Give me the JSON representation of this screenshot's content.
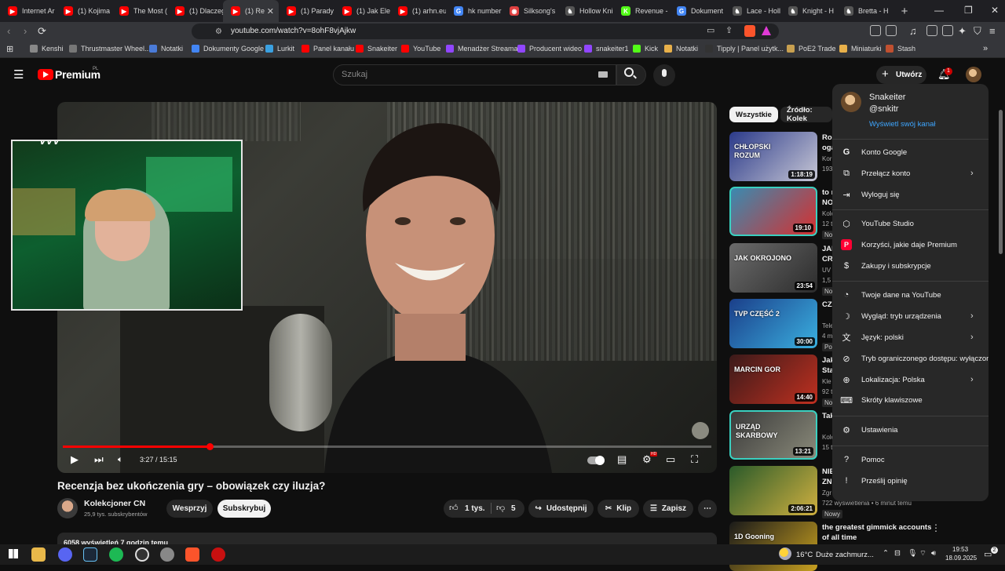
{
  "browser": {
    "tabs": [
      {
        "label": "Internet Ar",
        "fav": "#ff0000",
        "fav_glyph": "▶"
      },
      {
        "label": "(1) Kojima",
        "fav": "#ff0000",
        "fav_glyph": "▶"
      },
      {
        "label": "The Most (",
        "fav": "#ff0000",
        "fav_glyph": "▶"
      },
      {
        "label": "(1) Dlaczeg",
        "fav": "#ff0000",
        "fav_glyph": "▶"
      },
      {
        "label": "(1) Re",
        "fav": "#ff0000",
        "fav_glyph": "▶",
        "active": true
      },
      {
        "label": "(1) Parady",
        "fav": "#ff0000",
        "fav_glyph": "▶"
      },
      {
        "label": "(1) Jak Ele",
        "fav": "#ff0000",
        "fav_glyph": "▶"
      },
      {
        "label": "(1) arhn.eu",
        "fav": "#ff0000",
        "fav_glyph": "▶"
      },
      {
        "label": "hk number",
        "fav": "#4285f4",
        "fav_glyph": "G"
      },
      {
        "label": "Silksong's",
        "fav": "#e04040",
        "fav_glyph": "◉"
      },
      {
        "label": "Hollow Kni",
        "fav": "#555555",
        "fav_glyph": "♞"
      },
      {
        "label": "Revenue -",
        "fav": "#53fc18",
        "fav_glyph": "K"
      },
      {
        "label": "Dokument",
        "fav": "#4285f4",
        "fav_glyph": "G"
      },
      {
        "label": "Lace - Holl",
        "fav": "#555555",
        "fav_glyph": "♞"
      },
      {
        "label": "Knight - H",
        "fav": "#555555",
        "fav_glyph": "♞"
      },
      {
        "label": "Bretta - H",
        "fav": "#555555",
        "fav_glyph": "♞"
      }
    ],
    "url": "youtube.com/watch?v=8ohF8vjAjkw",
    "bookmarks": [
      {
        "label": "Kenshi",
        "color": "#888888"
      },
      {
        "label": "Thrustmaster Wheel...",
        "color": "#777777"
      },
      {
        "label": "Notatki",
        "color": "#4a7bd8"
      },
      {
        "label": "Dokumenty Google",
        "color": "#4285f4"
      },
      {
        "label": "Lurkit",
        "color": "#3aa0e0"
      },
      {
        "label": "Panel kanału",
        "color": "#ff0000"
      },
      {
        "label": "Snakeiter",
        "color": "#ff0000"
      },
      {
        "label": "YouTube",
        "color": "#ff0000"
      },
      {
        "label": "Menadżer Streama",
        "color": "#9146ff"
      },
      {
        "label": "Producent wideo",
        "color": "#9146ff"
      },
      {
        "label": "snakeiter1",
        "color": "#9146ff"
      },
      {
        "label": "Kick",
        "color": "#53fc18"
      },
      {
        "label": "Notatki",
        "color": "#e8b04a"
      },
      {
        "label": "Tipply | Panel użytk...",
        "color": "#333333"
      },
      {
        "label": "PoE2 Trade",
        "color": "#c8a050"
      },
      {
        "label": "Miniaturki",
        "color": "#e8b04a"
      },
      {
        "label": "Stash",
        "color": "#c05030"
      }
    ]
  },
  "youtube": {
    "logo_text": "Premium",
    "logo_region": "PL",
    "search_placeholder": "Szukaj",
    "create_label": "Utwórz",
    "notif_count": "1"
  },
  "player": {
    "time_current": "3:27",
    "time_total": "15:15",
    "time_display": "3:27 / 15:15",
    "progress": 0.226,
    "quality_badge": "HD"
  },
  "video": {
    "title": "Recenzja bez ukończenia gry – obowiązek czy iluzja?",
    "channel": "Kolekcjoner CN",
    "subscribers": "25,9 tys. subskrybentów",
    "support_label": "Wesprzyj",
    "subscribe_label": "Subskrybuj",
    "likes": "1 tys.",
    "dislikes": "5",
    "share_label": "Udostępnij",
    "clip_label": "Klip",
    "save_label": "Zapisz",
    "desc_stats": "6058 wyświetleń  7 godzin temu"
  },
  "sidebar": {
    "chips": [
      {
        "label": "Wszystkie",
        "active": true
      },
      {
        "label": "Źródło: Kolek",
        "active": false
      }
    ],
    "items": [
      {
        "title": "Rol",
        "title2": "oga",
        "meta": "Kor",
        "meta2": "193",
        "duration": "1:18:19",
        "thumb_text": "CHŁOPSKI ROZUM",
        "bg1": "#2b3a8a",
        "bg2": "#c7c7d5"
      },
      {
        "title": "to r",
        "title2": "NO",
        "meta": "Kolo",
        "meta2": "12 t",
        "badge": "No",
        "duration": "19:10",
        "thumb_text": "",
        "bg1": "#3a8ab0",
        "bg2": "#d63030"
      },
      {
        "title": "JAK",
        "title2": "CRI",
        "meta": "UV",
        "meta2": "1,5",
        "badge": "No",
        "duration": "23:54",
        "thumb_text": "JAK OKROJONO",
        "bg1": "#6b6b6b",
        "bg2": "#2c2c2c"
      },
      {
        "title": "CZ",
        "title2": "",
        "meta": "Tele",
        "meta2": "4 m",
        "badge": "Po",
        "duration": "30:00",
        "thumb_text": "TVP  CZĘŚĆ 2",
        "bg1": "#1b3f8a",
        "bg2": "#3ab0e0"
      },
      {
        "title": "Jak",
        "title2": "Sta",
        "meta": "Kle",
        "meta2": "92 t",
        "badge": "No",
        "duration": "14:40",
        "thumb_text": "MARCIN GOR",
        "bg1": "#3a1a1a",
        "bg2": "#c03020"
      },
      {
        "title": "Tak",
        "title2": "",
        "meta": "Kolo",
        "meta2": "15 t",
        "badge": "",
        "duration": "13:21",
        "thumb_text": "URZĄD SKARBOWY",
        "bg1": "#3a3a3a",
        "bg2": "#8a8a7a"
      },
      {
        "title": "NIE",
        "title2": "ZN",
        "meta": "Zgr",
        "meta2": "722 wyświetlenia • 6 minut temu",
        "badge": "Nowy",
        "duration": "2:06:21",
        "thumb_text": "",
        "bg1": "#2a5a2a",
        "bg2": "#d0b040"
      },
      {
        "title": "the greatest gimmick accounts",
        "title2": "of all time",
        "meta": "",
        "meta2": "",
        "badge": "",
        "duration": "",
        "thumb_text": "1D Gooning",
        "bg1": "#1a1a1a",
        "bg2": "#c8a020"
      }
    ]
  },
  "account_menu": {
    "name": "Snakeiter",
    "handle": "@snkitr",
    "view_channel": "Wyświetl swój kanał",
    "groups": [
      [
        {
          "icon": "google-icon",
          "glyph": "G",
          "label": "Konto Google",
          "arrow": false
        },
        {
          "icon": "switch-account-icon",
          "glyph": "⧉",
          "label": "Przełącz konto",
          "arrow": true
        },
        {
          "icon": "sign-out-icon",
          "glyph": "⇥",
          "label": "Wyloguj się",
          "arrow": false
        }
      ],
      [
        {
          "icon": "studio-icon",
          "glyph": "⬡",
          "label": "YouTube Studio",
          "arrow": false
        },
        {
          "icon": "premium-icon",
          "glyph": "P",
          "label": "Korzyści, jakie daje Premium",
          "arrow": false
        },
        {
          "icon": "purchases-icon",
          "glyph": "$",
          "label": "Zakupy i subskrypcje",
          "arrow": false
        }
      ],
      [
        {
          "icon": "your-data-icon",
          "glyph": "◔",
          "label": "Twoje dane na YouTube",
          "arrow": false
        },
        {
          "icon": "appearance-icon",
          "glyph": "☽",
          "label": "Wygląd: tryb urządzenia",
          "arrow": true
        },
        {
          "icon": "language-icon",
          "glyph": "文",
          "label": "Język: polski",
          "arrow": true
        },
        {
          "icon": "restricted-mode-icon",
          "glyph": "⊘",
          "label": "Tryb ograniczonego dostępu: wyłączony",
          "arrow": false
        },
        {
          "icon": "location-icon",
          "glyph": "⊕",
          "label": "Lokalizacja: Polska",
          "arrow": true
        },
        {
          "icon": "keyboard-icon",
          "glyph": "⌨",
          "label": "Skróty klawiszowe",
          "arrow": false
        }
      ],
      [
        {
          "icon": "settings-icon",
          "glyph": "⚙",
          "label": "Ustawienia",
          "arrow": false
        }
      ],
      [
        {
          "icon": "help-icon",
          "glyph": "?",
          "label": "Pomoc",
          "arrow": false
        },
        {
          "icon": "feedback-icon",
          "glyph": "!",
          "label": "Prześlij opinię",
          "arrow": false
        }
      ]
    ]
  },
  "taskbar": {
    "weather": "16°C",
    "weather_desc": "Duże zachmurz...",
    "time": "19:53",
    "date": "18.09.2025",
    "notif_count": "2"
  }
}
